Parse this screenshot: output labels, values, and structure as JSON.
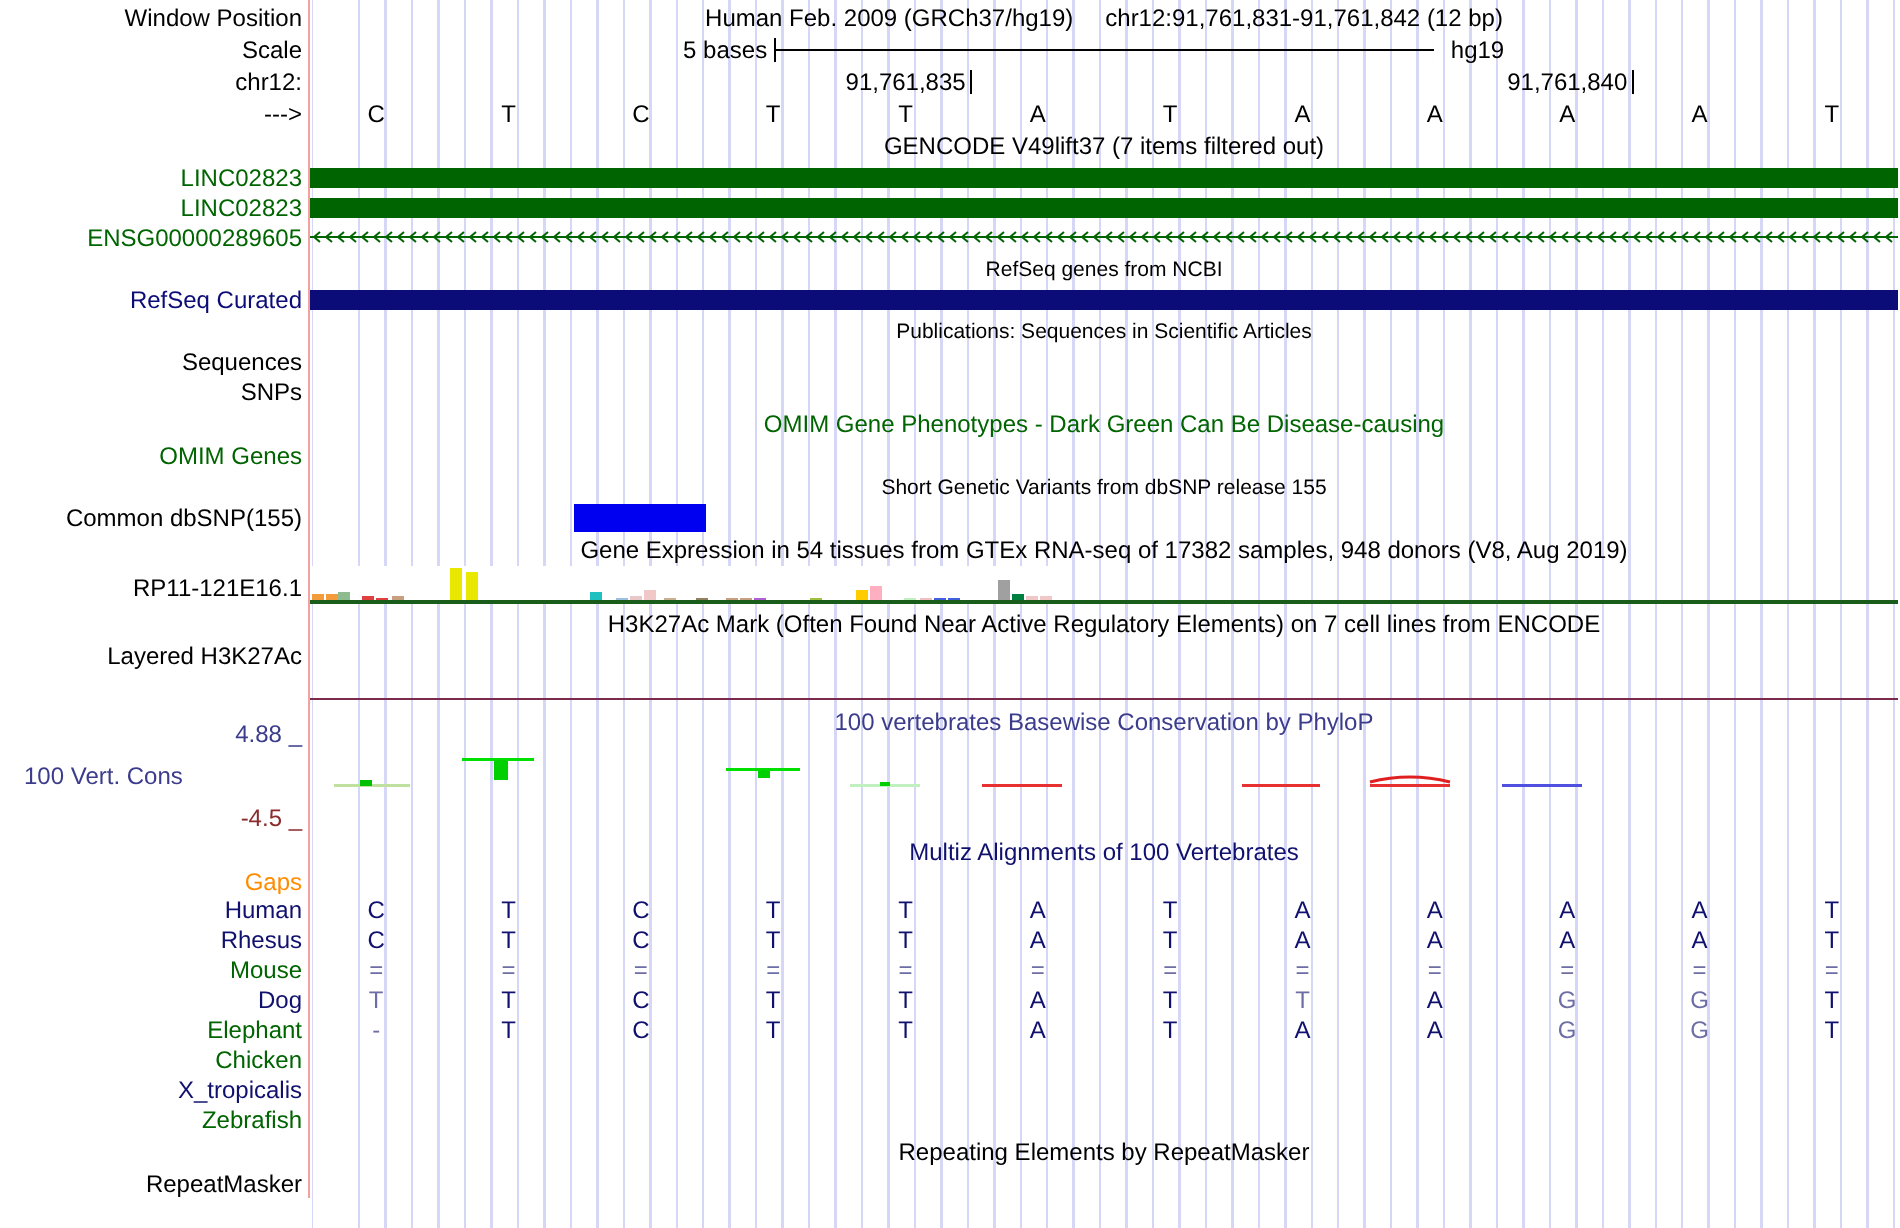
{
  "header": {
    "position_label": "Window Position",
    "assembly": "Human Feb. 2009 (GRCh37/hg19)",
    "range": "chr12:91,761,831-91,761,842 (12 bp)",
    "scale_label": "Scale",
    "scale_text": "5 bases",
    "scale_assembly": "hg19",
    "chrom_label": "chr12:",
    "ruler": [
      {
        "kind": "blank"
      },
      {
        "kind": "blank"
      },
      {
        "kind": "blank"
      },
      {
        "kind": "blank"
      },
      {
        "kind": "tick",
        "label": "91,761,835"
      },
      {
        "kind": "blank"
      },
      {
        "kind": "blank"
      },
      {
        "kind": "blank"
      },
      {
        "kind": "blank"
      },
      {
        "kind": "tick",
        "label": "91,761,840"
      },
      {
        "kind": "blank"
      },
      {
        "kind": "blank"
      }
    ],
    "strand_label": "--->",
    "bases": [
      "C",
      "T",
      "C",
      "T",
      "T",
      "A",
      "T",
      "A",
      "A",
      "A",
      "A",
      "T"
    ]
  },
  "tracks": [
    {
      "kind": "title",
      "text": "GENCODE V49lift37 (7 items filtered out)",
      "color": "#000000"
    },
    {
      "kind": "gene_bar",
      "label": "LINC02823",
      "color": "#006400"
    },
    {
      "kind": "gene_bar",
      "label": "LINC02823",
      "color": "#006400"
    },
    {
      "kind": "gene_arrows",
      "label": "ENSG00000289605",
      "color": "#006400"
    },
    {
      "kind": "note",
      "text": "RefSeq genes from NCBI"
    },
    {
      "kind": "gene_bar",
      "label": "RefSeq Curated",
      "color": "#0c0c78"
    },
    {
      "kind": "note",
      "text": "Publications: Sequences in Scientific Articles"
    },
    {
      "kind": "label",
      "label": "Sequences",
      "color": "#000000"
    },
    {
      "kind": "label",
      "label": "SNPs",
      "color": "#000000"
    },
    {
      "kind": "title",
      "text": "OMIM Gene Phenotypes - Dark Green Can Be Disease-causing",
      "color": "#006400"
    },
    {
      "kind": "label",
      "label": "OMIM Genes",
      "color": "#006400"
    },
    {
      "kind": "note",
      "text": "Short Genetic Variants from dbSNP release 155"
    },
    {
      "kind": "variants",
      "label": "Common dbSNP(155)",
      "color": "#000000",
      "marks": [
        false,
        false,
        true,
        false,
        false,
        false,
        false,
        false,
        false,
        false,
        false,
        false
      ]
    },
    {
      "kind": "title",
      "text": "Gene Expression in 54 tissues from GTEx RNA-seq of 17382 samples, 948 donors (V8, Aug 2019)",
      "color": "#000000"
    },
    {
      "kind": "expression",
      "label": "RP11-121E16.1",
      "color": "#000000"
    },
    {
      "kind": "title",
      "text": "H3K27Ac Mark (Often Found Near Active Regulatory Elements) on 7 cell lines from ENCODE",
      "color": "#000000"
    },
    {
      "kind": "signal",
      "label": "Layered H3K27Ac",
      "color": "#000000"
    },
    {
      "kind": "conservation",
      "title": "100 vertebrates Basewise Conservation by PhyloP",
      "label": "100 Vert. Cons",
      "max": "4.88 _",
      "min": "-4.5 _",
      "color": "#3c3c8c"
    },
    {
      "kind": "title",
      "text": "Multiz Alignments of 100 Vertebrates",
      "color": "#10106e"
    },
    {
      "kind": "gaps",
      "label": "Gaps",
      "color": "#ff8c00"
    },
    {
      "kind": "alignment",
      "label": "Human",
      "color": "#10106e",
      "bases": [
        "C",
        "T",
        "C",
        "T",
        "T",
        "A",
        "T",
        "A",
        "A",
        "A",
        "A",
        "T"
      ],
      "faded": [
        false,
        false,
        false,
        false,
        false,
        false,
        false,
        false,
        false,
        false,
        false,
        false
      ]
    },
    {
      "kind": "alignment",
      "label": "Rhesus",
      "color": "#10106e",
      "bases": [
        "C",
        "T",
        "C",
        "T",
        "T",
        "A",
        "T",
        "A",
        "A",
        "A",
        "A",
        "T"
      ],
      "faded": [
        false,
        false,
        false,
        false,
        false,
        false,
        false,
        false,
        false,
        false,
        false,
        false
      ]
    },
    {
      "kind": "alignment",
      "label": "Mouse",
      "color": "#006400",
      "bases": [
        "=",
        "=",
        "=",
        "=",
        "=",
        "=",
        "=",
        "=",
        "=",
        "=",
        "=",
        "="
      ],
      "faded": [
        true,
        true,
        true,
        true,
        true,
        true,
        true,
        true,
        true,
        true,
        true,
        true
      ]
    },
    {
      "kind": "alignment",
      "label": "Dog",
      "color": "#10106e",
      "bases": [
        "T",
        "T",
        "C",
        "T",
        "T",
        "A",
        "T",
        "T",
        "A",
        "G",
        "G",
        "T"
      ],
      "faded": [
        true,
        false,
        false,
        false,
        false,
        false,
        false,
        true,
        false,
        true,
        true,
        false
      ]
    },
    {
      "kind": "alignment",
      "label": "Elephant",
      "color": "#006400",
      "bases": [
        "-",
        "T",
        "C",
        "T",
        "T",
        "A",
        "T",
        "A",
        "A",
        "G",
        "G",
        "T"
      ],
      "faded": [
        true,
        false,
        false,
        false,
        false,
        false,
        false,
        false,
        false,
        true,
        true,
        false
      ]
    },
    {
      "kind": "species",
      "label": "Chicken",
      "color": "#006400"
    },
    {
      "kind": "species",
      "label": "X_tropicalis",
      "color": "#10106e"
    },
    {
      "kind": "species",
      "label": "Zebrafish",
      "color": "#006400"
    },
    {
      "kind": "title",
      "text": "Repeating Elements by RepeatMasker",
      "color": "#000000"
    },
    {
      "kind": "label",
      "label": "RepeatMasker",
      "color": "#000000"
    }
  ]
}
